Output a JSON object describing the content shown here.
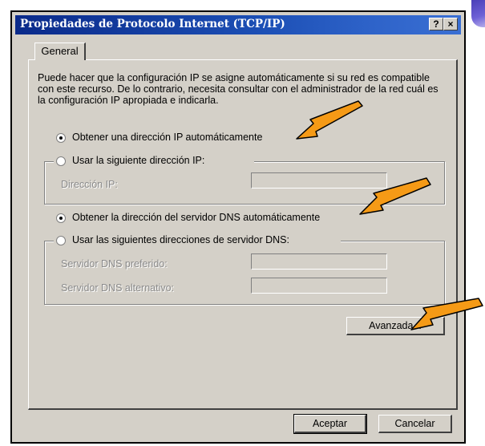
{
  "window": {
    "title": "Propiedades de Protocolo Internet (TCP/IP)",
    "help_label": "?",
    "close_label": "×"
  },
  "tabs": [
    "General"
  ],
  "intro_text": "Puede hacer que la configuración IP se asigne automáticamente si su red es compatible con este recurso. De lo contrario, necesita consultar con el administrador de la red cuál es la configuración IP apropiada e indicarla.",
  "ip": {
    "auto_label": "Obtener una dirección IP automáticamente",
    "manual_label": "Usar la siguiente dirección IP:",
    "selected": "auto",
    "address_label": "Dirección IP:",
    "address_value": ""
  },
  "dns": {
    "auto_label": "Obtener la dirección del servidor DNS automáticamente",
    "manual_label": "Usar las siguientes direcciones de servidor DNS:",
    "selected": "auto",
    "preferred_label": "Servidor DNS preferido:",
    "preferred_value": "",
    "alternate_label": "Servidor DNS alternativo:",
    "alternate_value": ""
  },
  "buttons": {
    "advanced": "Avanzada...",
    "ok": "Aceptar",
    "cancel": "Cancelar"
  },
  "colors": {
    "title_start": "#0a2a8a",
    "title_end": "#3a6fd3",
    "face": "#d4d0c8",
    "annotation_arrow": "#f59a16"
  }
}
